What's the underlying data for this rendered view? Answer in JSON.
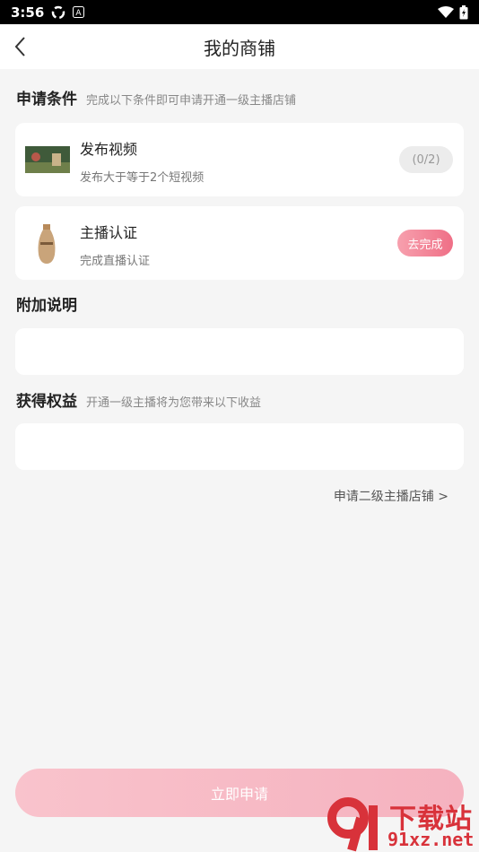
{
  "status_bar": {
    "time": "3:56"
  },
  "nav": {
    "title": "我的商铺"
  },
  "conditions": {
    "title": "申请条件",
    "subtitle": "完成以下条件即可申请开通一级主播店铺",
    "tasks": [
      {
        "title": "发布视频",
        "desc": "发布大于等于2个短视频",
        "status": "(0/2)"
      },
      {
        "title": "主播认证",
        "desc": "完成直播认证",
        "status": "去完成"
      }
    ]
  },
  "extra": {
    "title": "附加说明"
  },
  "benefits": {
    "title": "获得权益",
    "subtitle": "开通一级主播将为您带来以下收益"
  },
  "next_level_link": "申请二级主播店铺 >",
  "apply_button": "立即申请",
  "watermark": {
    "text": "下载站",
    "url": "91xz.net"
  },
  "colors": {
    "accent_pink": "#ef6f86",
    "button_pink": "#f7b8c3"
  }
}
